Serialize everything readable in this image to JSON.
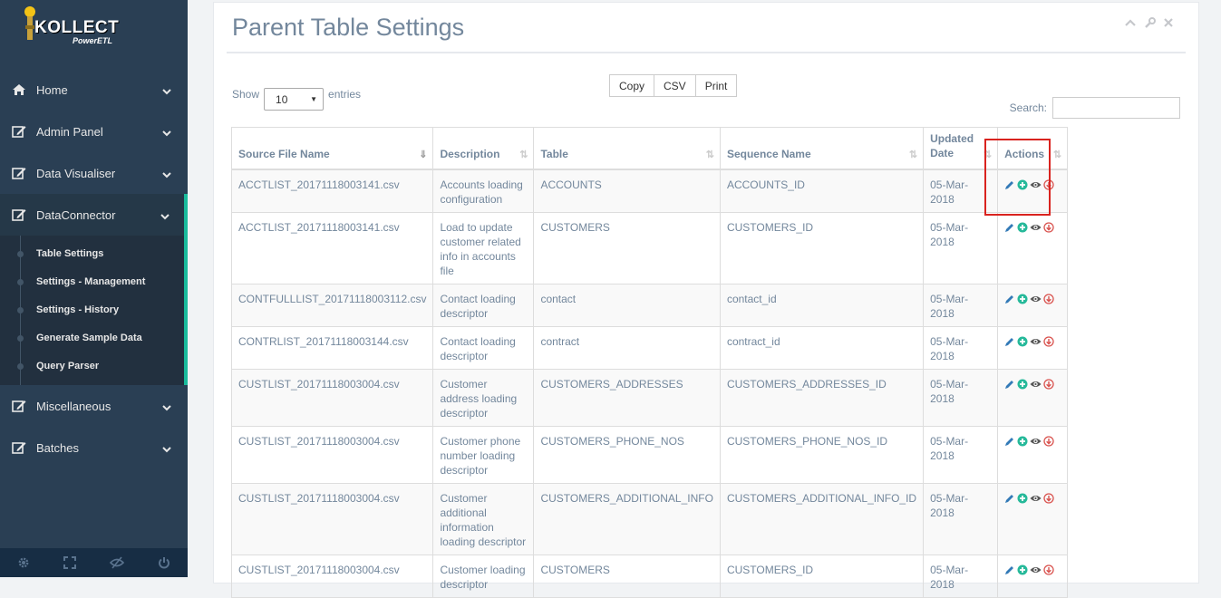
{
  "brand": {
    "name": "KOLLECT",
    "tagline": "PowerETL"
  },
  "sidebar": {
    "items": [
      {
        "label": "Home",
        "icon": "home-icon"
      },
      {
        "label": "Admin Panel",
        "icon": "edit-icon"
      },
      {
        "label": "Data Visualiser",
        "icon": "edit-icon"
      },
      {
        "label": "DataConnector",
        "icon": "edit-icon"
      }
    ],
    "submenu": [
      "Table Settings",
      "Settings - Management",
      "Settings - History",
      "Generate Sample Data",
      "Query Parser"
    ],
    "items_after": [
      {
        "label": "Miscellaneous",
        "icon": "edit-icon"
      },
      {
        "label": "Batches",
        "icon": "edit-icon"
      }
    ],
    "footer_icons": [
      "gear-icon",
      "fullscreen-icon",
      "eye-slash-icon",
      "power-icon"
    ]
  },
  "panel": {
    "title": "Parent Table Settings",
    "show_label": "Show",
    "entries_value": "10",
    "entries_label": "entries",
    "buttons": [
      "Copy",
      "CSV",
      "Print"
    ],
    "search_label": "Search:",
    "search_value": ""
  },
  "table": {
    "columns": [
      "Source File Name",
      "Description",
      "Table",
      "Sequence Name",
      "Updated Date",
      "Actions"
    ],
    "rows": [
      [
        "ACCTLIST_20171118003141.csv",
        "Accounts loading configuration",
        "ACCOUNTS",
        "ACCOUNTS_ID",
        "05-Mar-2018"
      ],
      [
        "ACCTLIST_20171118003141.csv",
        "Load to update customer related info in accounts file",
        "CUSTOMERS",
        "CUSTOMERS_ID",
        "05-Mar-2018"
      ],
      [
        "CONTFULLLIST_20171118003112.csv",
        "Contact loading descriptor",
        "contact",
        "contact_id",
        "05-Mar-2018"
      ],
      [
        "CONTRLIST_20171118003144.csv",
        "Contact loading descriptor",
        "contract",
        "contract_id",
        "05-Mar-2018"
      ],
      [
        "CUSTLIST_20171118003004.csv",
        "Customer address loading descriptor",
        "CUSTOMERS_ADDRESSES",
        "CUSTOMERS_ADDRESSES_ID",
        "05-Mar-2018"
      ],
      [
        "CUSTLIST_20171118003004.csv",
        "Customer phone number loading descriptor",
        "CUSTOMERS_PHONE_NOS",
        "CUSTOMERS_PHONE_NOS_ID",
        "05-Mar-2018"
      ],
      [
        "CUSTLIST_20171118003004.csv",
        "Customer additional information loading descriptor",
        "CUSTOMERS_ADDITIONAL_INFO",
        "CUSTOMERS_ADDITIONAL_INFO_ID",
        "05-Mar-2018"
      ],
      [
        "CUSTLIST_20171118003004.csv",
        "Customer loading descriptor",
        "CUSTOMERS",
        "CUSTOMERS_ID",
        "05-Mar-2018"
      ]
    ],
    "action_icons": [
      "edit-icon",
      "add-icon",
      "view-icon",
      "download-icon"
    ]
  },
  "colors": {
    "sidebar_bg": "#2a3f54",
    "accent": "#1abb9c",
    "highlight": "#d9231f",
    "edit": "#337ab7",
    "add": "#26b99a",
    "view": "#555555",
    "download": "#d9534f"
  }
}
